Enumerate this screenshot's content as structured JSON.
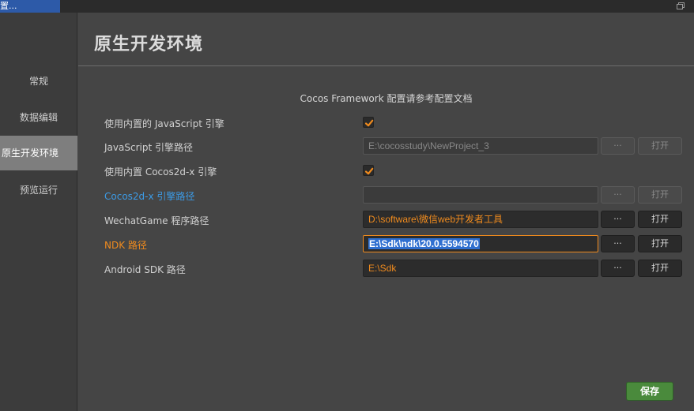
{
  "window": {
    "tab_title": "置..."
  },
  "sidebar": {
    "items": [
      {
        "label": "常规"
      },
      {
        "label": "数据编辑"
      },
      {
        "label": "原生开发环境"
      },
      {
        "label": "预览运行"
      }
    ]
  },
  "main": {
    "title": "原生开发环境",
    "note": "Cocos Framework 配置请参考配置文档",
    "rows": [
      {
        "label": "使用内置的 JavaScript 引擎",
        "checked": true
      },
      {
        "label": "JavaScript 引擎路径",
        "value": "E:\\cocosstudy\\NewProject_3",
        "dots": "···",
        "open": "打开"
      },
      {
        "label": "使用内置 Cocos2d-x 引擎",
        "checked": true
      },
      {
        "label": "Cocos2d-x 引擎路径",
        "value": "",
        "dots": "···",
        "open": "打开"
      },
      {
        "label": "WechatGame 程序路径",
        "value": "D:\\software\\微信web开发者工具",
        "dots": "···",
        "open": "打开"
      },
      {
        "label": "NDK 路径",
        "value": "E:\\Sdk\\ndk\\20.0.5594570",
        "dots": "···",
        "open": "打开"
      },
      {
        "label": "Android SDK 路径",
        "value": "E:\\Sdk",
        "dots": "···",
        "open": "打开"
      }
    ],
    "save_label": "保存"
  },
  "colors": {
    "accent_orange": "#f08b1e",
    "link_blue": "#3c9be6",
    "save_green": "#4a8a3c",
    "selection_blue": "#2f6fd0"
  }
}
